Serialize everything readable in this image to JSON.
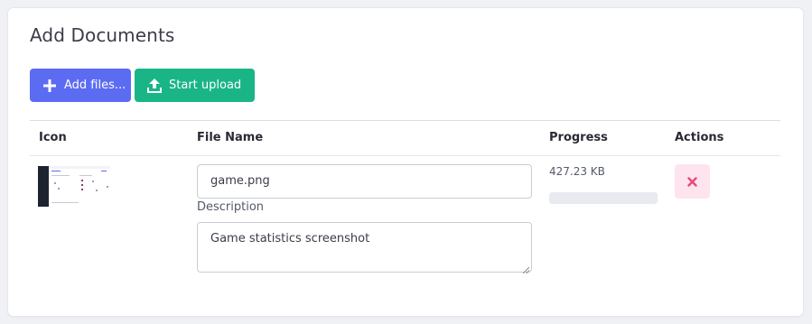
{
  "panel": {
    "title": "Add Documents"
  },
  "toolbar": {
    "add_label": "Add files...",
    "upload_label": "Start upload"
  },
  "table": {
    "headers": [
      "Icon",
      "File Name",
      "Progress",
      "Actions"
    ],
    "rows": [
      {
        "file_name": "game.png",
        "description_label": "Description",
        "description": "Game statistics screenshot",
        "size": "427.23 KB",
        "progress": 0
      }
    ]
  },
  "colors": {
    "primary": "#5b6cf2",
    "success": "#1ab586",
    "danger": "#e8487a",
    "danger_light": "#fde4ee"
  },
  "icons": {
    "add": "plus-icon",
    "upload": "upload-icon",
    "remove": "close-icon"
  }
}
